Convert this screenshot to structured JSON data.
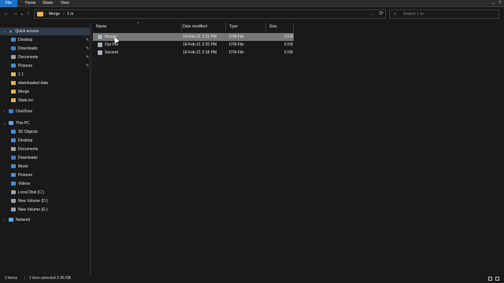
{
  "ribbon": {
    "tabs": [
      "File",
      "Home",
      "Share",
      "View"
    ],
    "right_icons": [
      "chevron-down-icon",
      "help-icon"
    ]
  },
  "address": {
    "back": "←",
    "forward": "→",
    "recent": "⌄",
    "up": "↑",
    "chevron_icon": "›",
    "path": [
      "Merge",
      "1 m"
    ],
    "dropdown_glyph": "⌄",
    "refresh_glyph": "⟳",
    "search_placeholder": "Search 1 m",
    "search_glyph": "⌕"
  },
  "nav": {
    "quick_access": {
      "label": "Quick access",
      "items": [
        {
          "label": "Desktop",
          "pinned": true
        },
        {
          "label": "Downloads",
          "pinned": true
        },
        {
          "label": "Documents",
          "pinned": true
        },
        {
          "label": "Pictures",
          "pinned": true
        },
        {
          "label": "1 1",
          "pinned": false
        },
        {
          "label": "downloaded data",
          "pinned": false
        },
        {
          "label": "Merge",
          "pinned": false
        },
        {
          "label": "Stata lec",
          "pinned": false
        }
      ]
    },
    "onedrive": "OneDrive",
    "this_pc": {
      "label": "This PC",
      "items": [
        "3D Objects",
        "Desktop",
        "Documents",
        "Downloads",
        "Music",
        "Pictures",
        "Videos",
        "Local Disk (C:)",
        "New Volume (D:)",
        "New Volume (E:)"
      ]
    },
    "network": "Network",
    "pin_glyph": "✎",
    "chevron_collapsed": "›",
    "chevron_expanded": "⌄"
  },
  "columns": {
    "name": "Name",
    "date": "Date modified",
    "type": "Type",
    "size": "Size",
    "sort_glyph": "^"
  },
  "files": [
    {
      "name": "Master",
      "date": "19-Feb-21 2:21 PM",
      "type": "DTA File",
      "size": "3 KB",
      "selected": true
    },
    {
      "name": "Out Put",
      "date": "19-Feb-21 2:20 PM",
      "type": "DTA File",
      "size": "6 KB",
      "selected": false
    },
    {
      "name": "Second",
      "date": "19-Feb-21 2:18 PM",
      "type": "DTA File",
      "size": "5 KB",
      "selected": false
    }
  ],
  "status": {
    "items": "3 items",
    "selected": "1 item selected  2.46 KB"
  },
  "colors": {
    "background": "#191919",
    "file_tab": "#1a73c9",
    "selected_row": "#777777",
    "folder": "#e8b34b"
  }
}
